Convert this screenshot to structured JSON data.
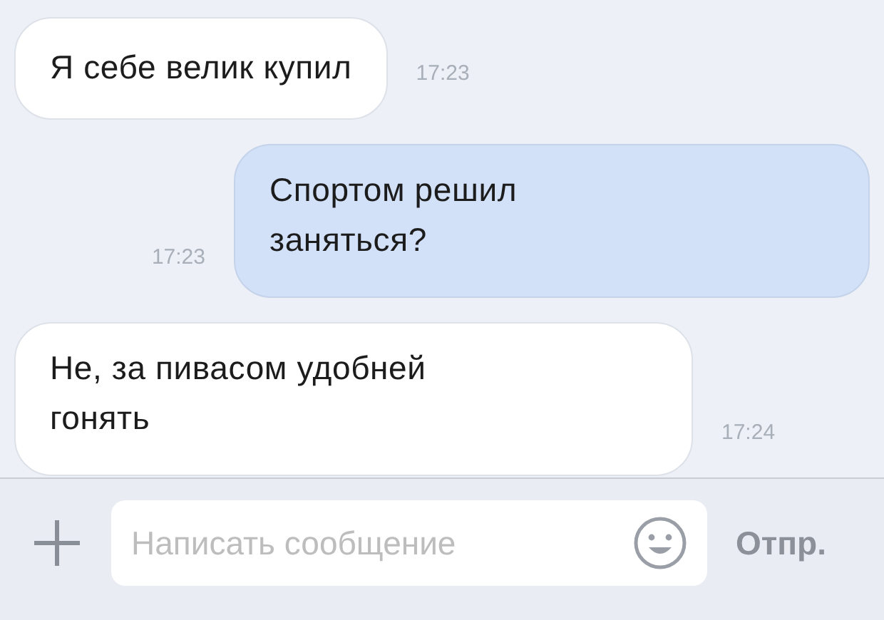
{
  "messages": [
    {
      "kind": "incoming",
      "text": "Я себе велик купил",
      "time": "17:23"
    },
    {
      "kind": "outgoing",
      "text": "Спортом решил\nзаняться?",
      "time": "17:23"
    },
    {
      "kind": "incoming",
      "text": "Не, за пивасом удобней\nгонять",
      "time": "17:24"
    }
  ],
  "composer": {
    "placeholder": "Написать сообщение",
    "send": "Отпр."
  }
}
